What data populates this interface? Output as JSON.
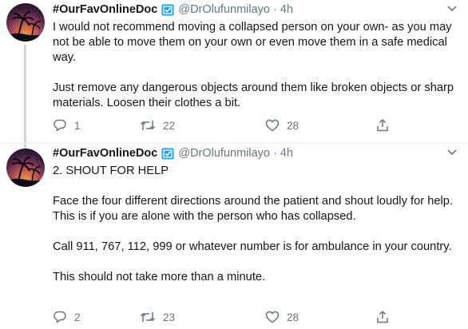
{
  "tweets": [
    {
      "author_name": "#OurFavOnlineDoc",
      "handle": "@DrOlufunmilayo",
      "separator": "·",
      "time": "4h",
      "paragraphs": [
        "I would not recommend moving a collapsed person on your own- as you may not be able to move them on your own or even move them in a safe medical way.",
        "Just remove any dangerous objects around them like broken objects or sharp materials. Loosen their clothes a bit."
      ],
      "replies": "1",
      "retweets": "22",
      "likes": "28"
    },
    {
      "author_name": "#OurFavOnlineDoc",
      "handle": "@DrOlufunmilayo",
      "separator": "·",
      "time": "4h",
      "paragraphs": [
        "2. SHOUT FOR HELP",
        "Face the four different directions around the patient and shout loudly for help.\nThis is if you are alone with the person who has collapsed.",
        "Call 911, 767, 112, 999 or whatever number is for ambulance in your country.",
        "This should not take more than a minute."
      ],
      "replies": "2",
      "retweets": "23",
      "likes": "28"
    }
  ],
  "colors": {
    "text": "#14171a",
    "secondary": "#657786",
    "verified_badge": "#1da1f2",
    "divider": "#e6ecf0"
  },
  "icons": [
    "verified-badge-icon",
    "chevron-down-icon",
    "reply-icon",
    "retweet-icon",
    "like-icon",
    "share-icon"
  ]
}
